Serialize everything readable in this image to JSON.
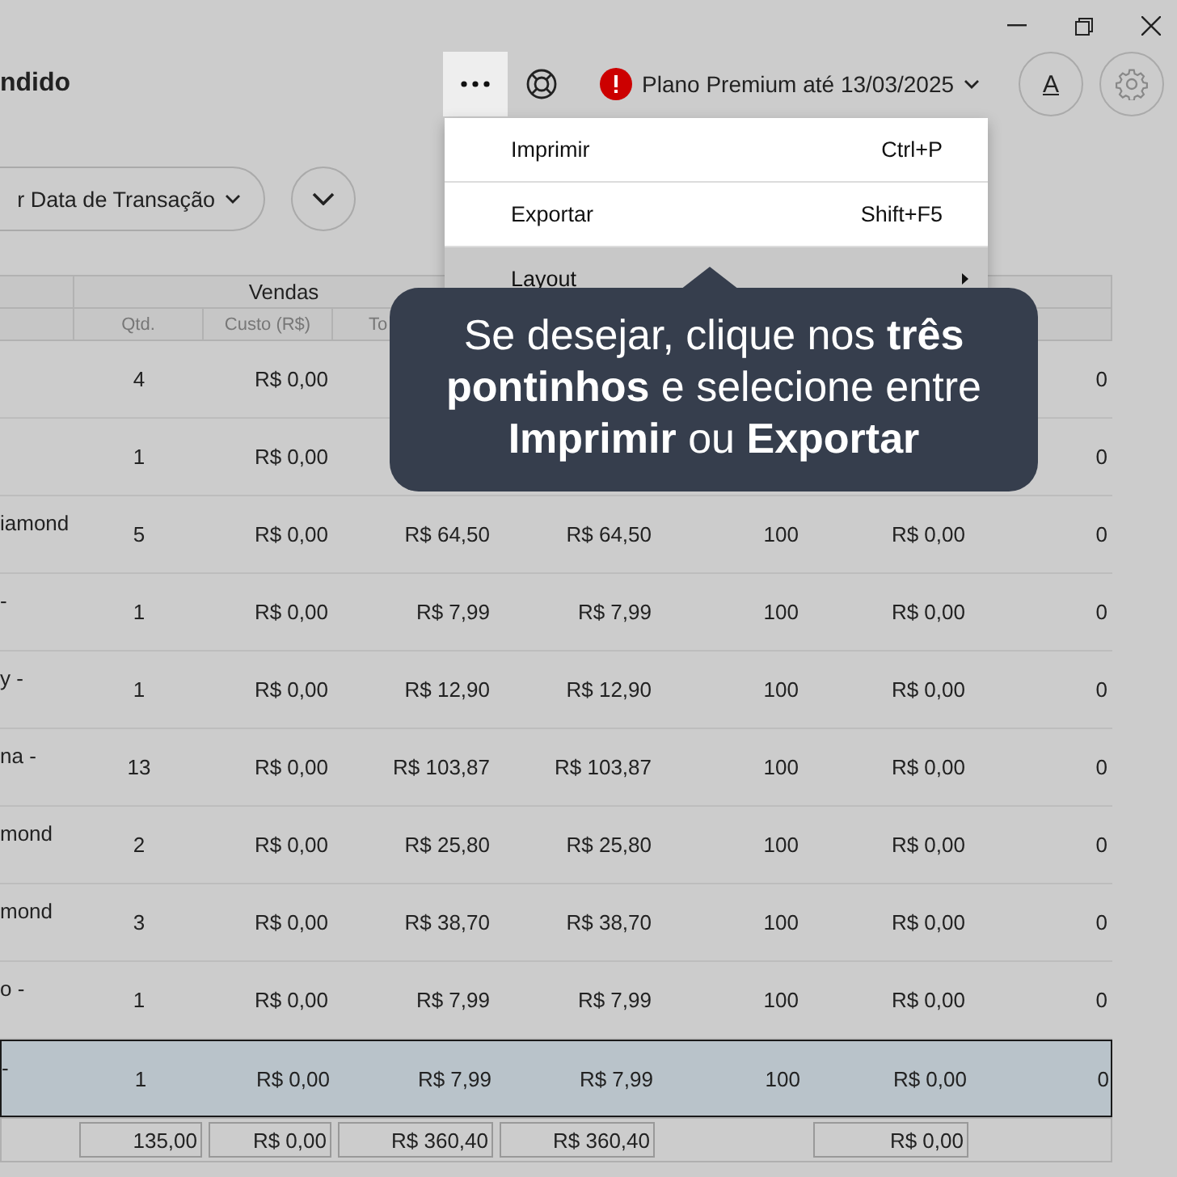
{
  "title": "ndido",
  "plan": {
    "label": "Plano Premium até 13/03/2025",
    "alert": true
  },
  "text_style_button": {
    "label": "A"
  },
  "filter": {
    "label": "r Data de Transação"
  },
  "table": {
    "group_header": "Vendas",
    "columns": [
      "",
      "Qtd.",
      "Custo (R$)",
      "To"
    ],
    "rows": [
      {
        "selected": false,
        "cells": [
          "",
          "4",
          "R$ 0,00",
          "",
          "",
          "",
          "",
          "0"
        ]
      },
      {
        "selected": false,
        "cells": [
          "",
          "1",
          "R$ 0,00",
          "",
          "",
          "",
          "",
          "0"
        ]
      },
      {
        "selected": false,
        "cells": [
          "iamond",
          "5",
          "R$ 0,00",
          "R$ 64,50",
          "R$ 64,50",
          "100",
          "R$ 0,00",
          "0"
        ]
      },
      {
        "selected": false,
        "cells": [
          "-",
          "1",
          "R$ 0,00",
          "R$ 7,99",
          "R$ 7,99",
          "100",
          "R$ 0,00",
          "0"
        ]
      },
      {
        "selected": false,
        "cells": [
          "y -",
          "1",
          "R$ 0,00",
          "R$ 12,90",
          "R$ 12,90",
          "100",
          "R$ 0,00",
          "0"
        ]
      },
      {
        "selected": false,
        "cells": [
          "na -",
          "13",
          "R$ 0,00",
          "R$ 103,87",
          "R$ 103,87",
          "100",
          "R$ 0,00",
          "0"
        ]
      },
      {
        "selected": false,
        "cells": [
          "mond",
          "2",
          "R$ 0,00",
          "R$ 25,80",
          "R$ 25,80",
          "100",
          "R$ 0,00",
          "0"
        ]
      },
      {
        "selected": false,
        "cells": [
          "mond",
          "3",
          "R$ 0,00",
          "R$ 38,70",
          "R$ 38,70",
          "100",
          "R$ 0,00",
          "0"
        ]
      },
      {
        "selected": false,
        "cells": [
          "o -",
          "1",
          "R$ 0,00",
          "R$ 7,99",
          "R$ 7,99",
          "100",
          "R$ 0,00",
          "0"
        ]
      },
      {
        "selected": true,
        "cells": [
          "-",
          "1",
          "R$ 0,00",
          "R$ 7,99",
          "R$ 7,99",
          "100",
          "R$ 0,00",
          "0"
        ]
      }
    ],
    "totals": {
      "qtd": "135,00",
      "custo": "R$ 0,00",
      "total": "R$ 360,40",
      "column_5": "R$ 360,40",
      "column_7": "R$ 0,00"
    }
  },
  "menu": {
    "items": [
      {
        "kind": "command",
        "label": "Imprimir",
        "shortcut": "Ctrl+P",
        "highlighted": true
      },
      {
        "kind": "command",
        "label": "Exportar",
        "shortcut": "Shift+F5",
        "highlighted": true
      },
      {
        "kind": "submenu",
        "label": "Layout",
        "highlighted": false
      }
    ]
  },
  "tooltip": {
    "text": "Se desejar, clique nos **três pontinhos** e selecione entre **Imprimir** ou **Exportar**"
  }
}
